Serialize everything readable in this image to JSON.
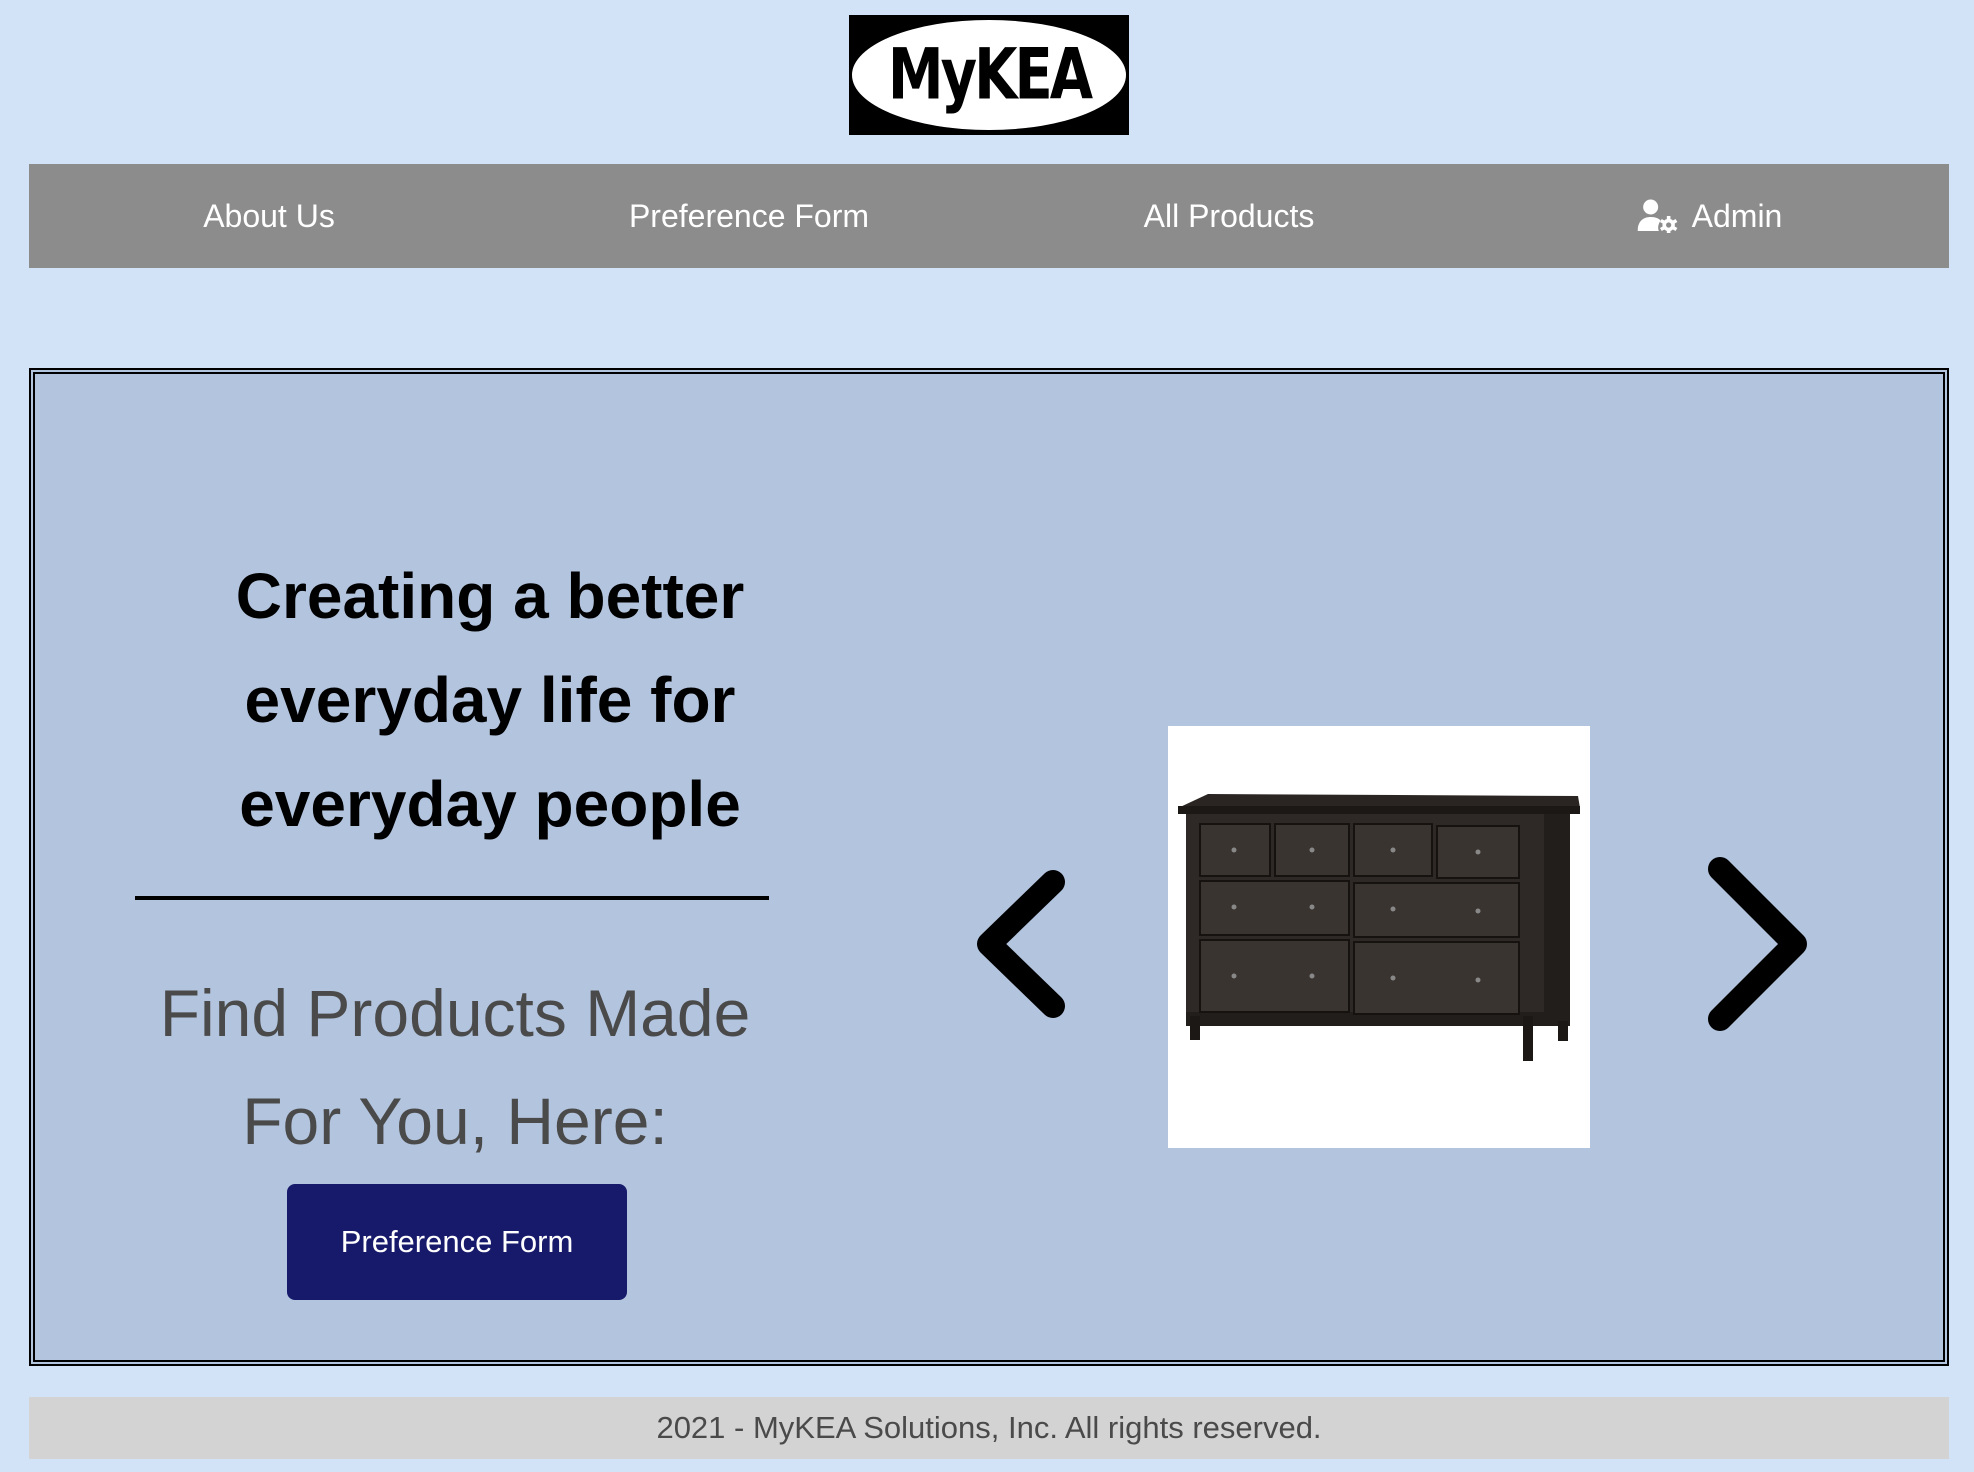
{
  "brand": {
    "logo_text": "MyKEA"
  },
  "nav": {
    "items": [
      {
        "label": "About Us"
      },
      {
        "label": "Preference Form"
      },
      {
        "label": "All Products"
      },
      {
        "label": "Admin",
        "icon": "user-gear-icon"
      }
    ]
  },
  "hero": {
    "headline": "Creating a better everyday life for everyday people",
    "subheadline": "Find Products Made For You, Here:",
    "cta_label": "Preference Form",
    "carousel": {
      "prev_icon": "chevron-left-icon",
      "next_icon": "chevron-right-icon",
      "current_image": "dresser-image"
    }
  },
  "footer": {
    "text": "2021 - MyKEA Solutions, Inc. All rights reserved."
  },
  "colors": {
    "page_bg": "#d2e3f8",
    "nav_bg": "#8c8c8c",
    "hero_bg": "#b3c4de",
    "cta_bg": "#171a6b",
    "footer_bg": "#d3d3d3"
  }
}
